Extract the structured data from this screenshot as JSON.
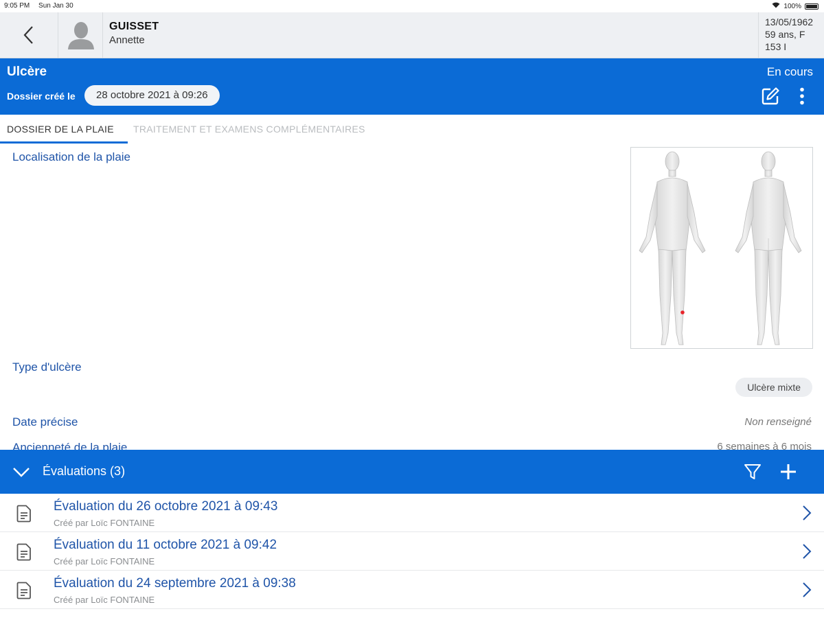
{
  "statusbar": {
    "time": "9:05 PM",
    "date": "Sun Jan 30",
    "battery": "100%"
  },
  "patient": {
    "last_name": "GUISSET",
    "first_name": "Annette",
    "birth_date": "13/05/1962",
    "age_sex": "59 ans, F",
    "room": "153 I"
  },
  "wound": {
    "title": "Ulcère",
    "created_label": "Dossier créé le",
    "created_date": "28 octobre 2021 à 09:26",
    "status": "En cours"
  },
  "tabs": [
    {
      "label": "DOSSIER DE LA PLAIE",
      "active": true
    },
    {
      "label": "TRAITEMENT ET EXAMENS COMPLÉMENTAIRES",
      "active": false
    }
  ],
  "fields": {
    "localisation_label": "Localisation de la plaie",
    "ulcer_type_label": "Type d'ulcère",
    "ulcer_type_value": "Ulcère mixte",
    "precise_date_label": "Date précise",
    "precise_date_value": "Non renseigné",
    "age_label": "Ancienneté de la plaie",
    "age_value": "6 semaines à 6 mois"
  },
  "evaluations": {
    "title": "Évaluations (3)",
    "items": [
      {
        "title": "Évaluation du 26 octobre 2021 à 09:43",
        "author": "Créé par Loïc FONTAINE"
      },
      {
        "title": "Évaluation du 11 octobre 2021 à 09:42",
        "author": "Créé par Loïc FONTAINE"
      },
      {
        "title": "Évaluation du 24 septembre 2021 à 09:38",
        "author": "Créé par Loïc FONTAINE"
      }
    ]
  },
  "colors": {
    "primary": "#0b6bd6",
    "label_blue": "#1f54a8",
    "marker": "#e8232a"
  },
  "icons": [
    "back-icon",
    "avatar-icon",
    "edit-icon",
    "more-vertical-icon",
    "chevron-down-icon",
    "filter-icon",
    "plus-icon",
    "document-icon",
    "chevron-right-icon"
  ]
}
